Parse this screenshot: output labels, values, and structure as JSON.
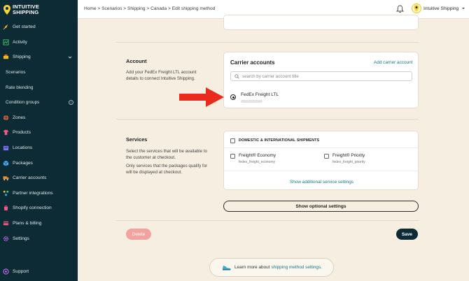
{
  "brand": {
    "name_line1": "INTUITIVE",
    "name_line2": "SHIPPING",
    "color": "#0c2b35",
    "accent": "#16768a"
  },
  "sidebar": {
    "items": [
      {
        "label": "Get started",
        "icon": "rocket-icon",
        "icon_color": "#f0b72a"
      },
      {
        "label": "Activity",
        "icon": "activity-icon",
        "icon_color": "#45c46c"
      },
      {
        "label": "Shipping",
        "icon": "shipping-icon",
        "icon_color": "#f0b72a"
      },
      {
        "label": "Scenarios"
      },
      {
        "label": "Rate blending"
      },
      {
        "label": "Condition groups"
      },
      {
        "label": "Zones",
        "icon": "globe-icon",
        "icon_color": "#ef6b3d"
      },
      {
        "label": "Products",
        "icon": "shirt-icon",
        "icon_color": "#ef5a80"
      },
      {
        "label": "Locations",
        "icon": "building-icon",
        "icon_color": "#7b6cf0"
      },
      {
        "label": "Packages",
        "icon": "box-icon",
        "icon_color": "#4aa8ef"
      },
      {
        "label": "Carrier accounts",
        "icon": "truck-icon",
        "icon_color": "#ef8a2a"
      },
      {
        "label": "Partner integrations",
        "icon": "integrations-icon",
        "icon_color": "#f0b72a"
      },
      {
        "label": "Shopify connection",
        "icon": "shopify-icon",
        "icon_color": "#ef5a80"
      },
      {
        "label": "Plans & billing",
        "icon": "billing-icon",
        "icon_color": "#ef5a80"
      },
      {
        "label": "Settings",
        "icon": "gear-icon",
        "icon_color": "#c86cf0"
      }
    ],
    "support_label": "Support"
  },
  "topbar": {
    "breadcrumb": "Home > Scenarios > Shipping > Canada > Edit shipping method",
    "user": "Intuitive Shipping"
  },
  "account": {
    "title": "Account",
    "desc": "Add your FedEx Freight LTL account details to connect Intuitive Shipping.",
    "card_title": "Carrier accounts",
    "add_link": "Add carrier account",
    "search_placeholder": "search by carrier account title",
    "carrier_name": "FedEx Freight LTL"
  },
  "services": {
    "title": "Services",
    "desc1": "Select the services that will be available to the customer at checkout.",
    "desc2": "Only services that the packages qualify for will be displayed at checkout.",
    "group_label": "DOMESTIC & INTERNATIONAL SHIPMENTS",
    "economy_name": "Freight® Economy",
    "economy_code": "fedex_freight_economy",
    "priority_name": "Freight® Priority",
    "priority_code": "fedex_freight_priority",
    "additional_link": "Show additional service settings"
  },
  "actions": {
    "optional_label": "Show optional settings",
    "delete_label": "Delete",
    "save_label": "Save"
  },
  "learn": {
    "prefix": "Learn more about",
    "link": "shipping method settings",
    "suffix": "."
  }
}
